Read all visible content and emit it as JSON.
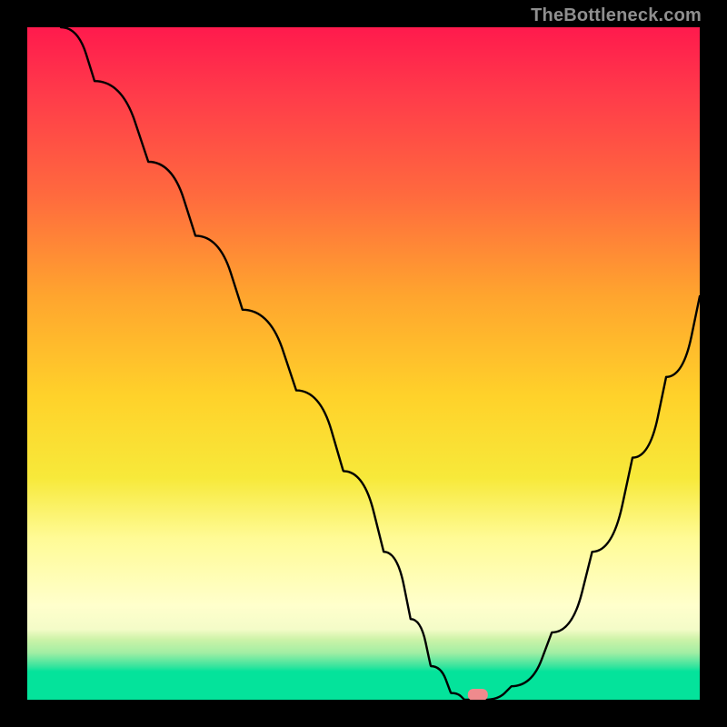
{
  "watermark": "TheBottleneck.com",
  "chart_data": {
    "type": "line",
    "title": "",
    "xlabel": "",
    "ylabel": "",
    "xlim": [
      0,
      100
    ],
    "ylim": [
      0,
      100
    ],
    "grid": false,
    "background": "vertical-gradient-red-to-green",
    "series": [
      {
        "name": "bottleneck-curve",
        "x": [
          5,
          10,
          18,
          25,
          32,
          40,
          47,
          53,
          57,
          60,
          63,
          65,
          68,
          72,
          78,
          84,
          90,
          95,
          100
        ],
        "y": [
          100,
          92,
          80,
          69,
          58,
          46,
          34,
          22,
          12,
          5,
          1,
          0,
          0,
          2,
          10,
          22,
          36,
          48,
          60
        ]
      }
    ],
    "marker": {
      "x": 67,
      "y": 0,
      "shape": "pill",
      "color": "#ef8a8d"
    },
    "annotations": []
  }
}
